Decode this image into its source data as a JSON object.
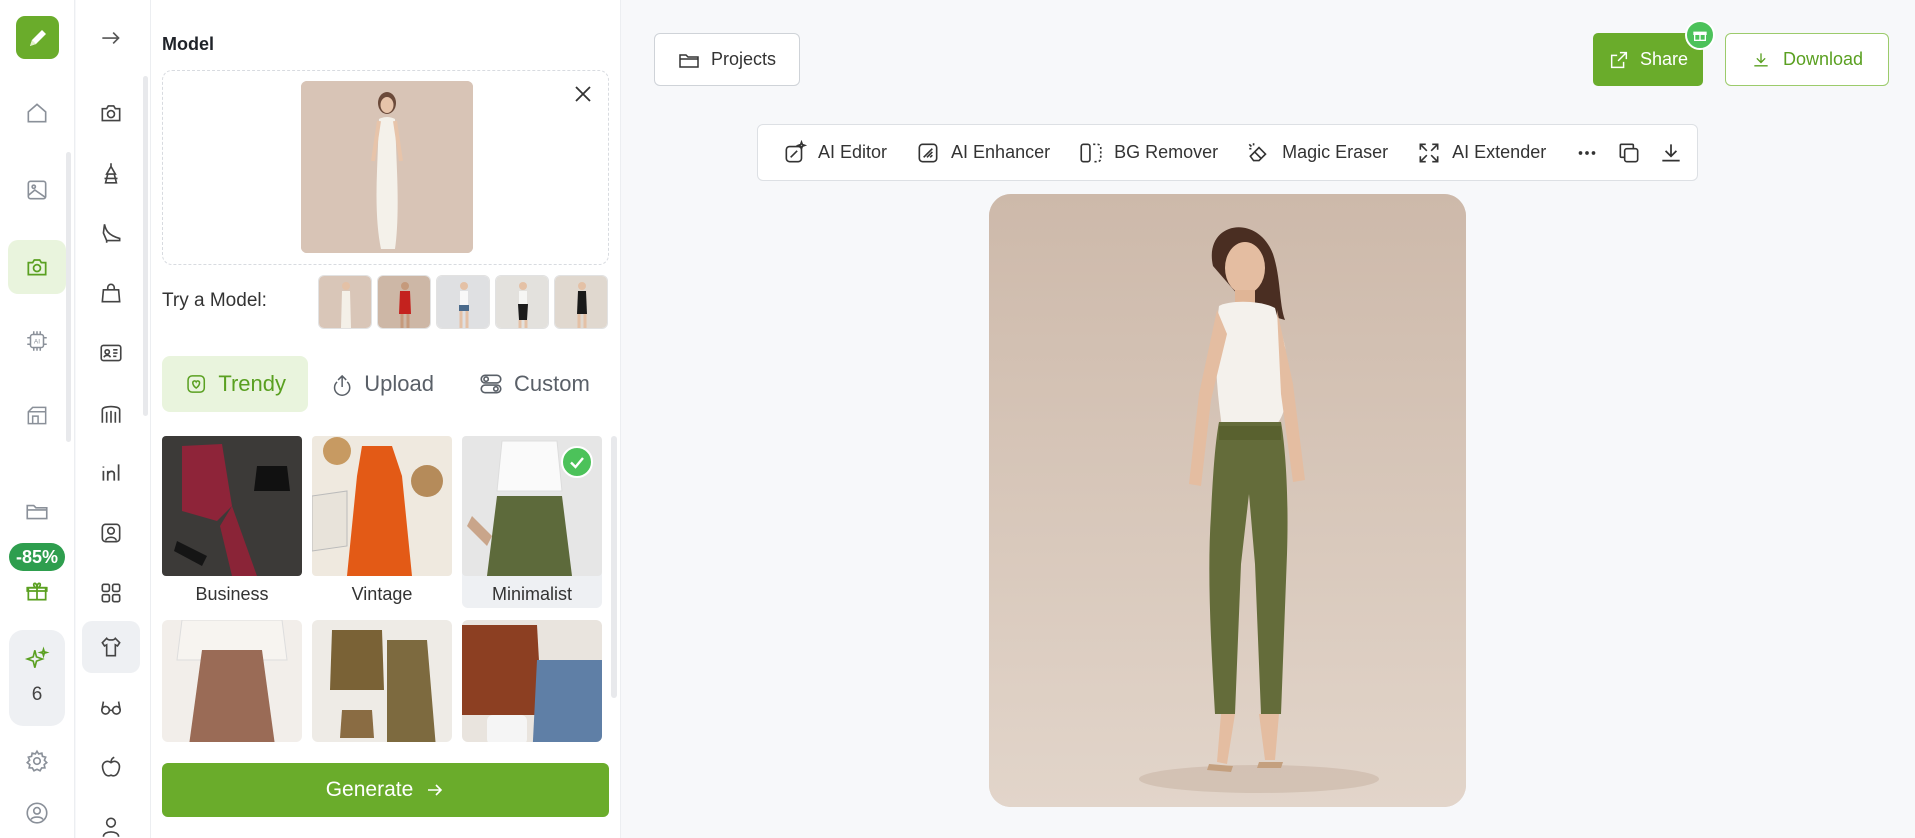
{
  "colors": {
    "accent": "#6aac2b",
    "accent_light": "#e9f4dd",
    "badge_green": "#2e9e4e",
    "check_green": "#4cc25a"
  },
  "rail": {
    "items": [
      "home-icon",
      "image-icon",
      "camera-icon",
      "ai-chip-icon",
      "shop-icon",
      "folder-icon",
      "gift-icon",
      "sparkle-icon",
      "gear-icon",
      "user-icon"
    ],
    "discount_badge": "-85%",
    "credits": "6"
  },
  "tools": {
    "items": [
      "arrow-right-icon",
      "camera-icon",
      "lamp-icon",
      "shoe-icon",
      "bag-icon",
      "id-card-icon",
      "arch-icon",
      "linkedin-icon",
      "portrait-icon",
      "grid-icon",
      "shirt-icon",
      "glasses-icon",
      "apple-icon",
      "user-bust-icon"
    ]
  },
  "panel": {
    "title": "Model",
    "try_label": "Try a Model:",
    "tabs": [
      {
        "label": "Trendy",
        "icon": "heart-frame-icon",
        "active": true
      },
      {
        "label": "Upload",
        "icon": "upload-icon",
        "active": false
      },
      {
        "label": "Custom",
        "icon": "toggles-icon",
        "active": false
      }
    ],
    "styles": [
      {
        "label": "Business",
        "selected": false
      },
      {
        "label": "Vintage",
        "selected": false
      },
      {
        "label": "Minimalist",
        "selected": true
      },
      {
        "label": "",
        "selected": false
      },
      {
        "label": "",
        "selected": false
      },
      {
        "label": "",
        "selected": false
      }
    ],
    "generate_label": "Generate"
  },
  "header": {
    "projects_label": "Projects",
    "share_label": "Share",
    "download_label": "Download"
  },
  "toolbar": {
    "items": [
      "AI Editor",
      "AI Enhancer",
      "BG Remover",
      "Magic Eraser",
      "AI Extender"
    ]
  }
}
